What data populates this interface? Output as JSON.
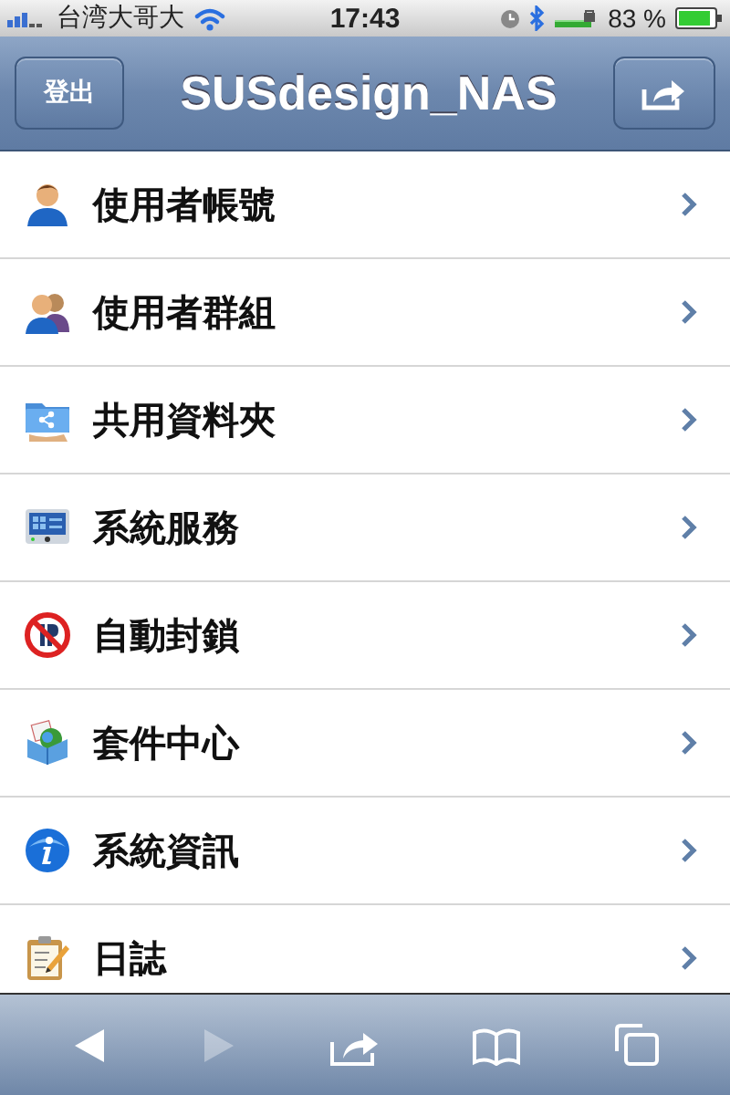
{
  "status_bar": {
    "carrier": "台湾大哥大",
    "time": "17:43",
    "battery_percent": "83 %"
  },
  "nav_bar": {
    "left_button": "登出",
    "title": "SUSdesign_NAS"
  },
  "menu": [
    {
      "kind": "user",
      "label": "使用者帳號"
    },
    {
      "kind": "group",
      "label": "使用者群組"
    },
    {
      "kind": "shared-folder",
      "label": "共用資料夾"
    },
    {
      "kind": "services",
      "label": "系統服務"
    },
    {
      "kind": "block",
      "label": "自動封鎖"
    },
    {
      "kind": "package",
      "label": "套件中心"
    },
    {
      "kind": "info",
      "label": "系統資訊"
    },
    {
      "kind": "log",
      "label": "日誌"
    }
  ],
  "toolbar": [
    {
      "kind": "back",
      "disabled": false
    },
    {
      "kind": "forward",
      "disabled": true
    },
    {
      "kind": "share",
      "disabled": false
    },
    {
      "kind": "bookmarks",
      "disabled": false
    },
    {
      "kind": "tabs",
      "disabled": false
    }
  ]
}
